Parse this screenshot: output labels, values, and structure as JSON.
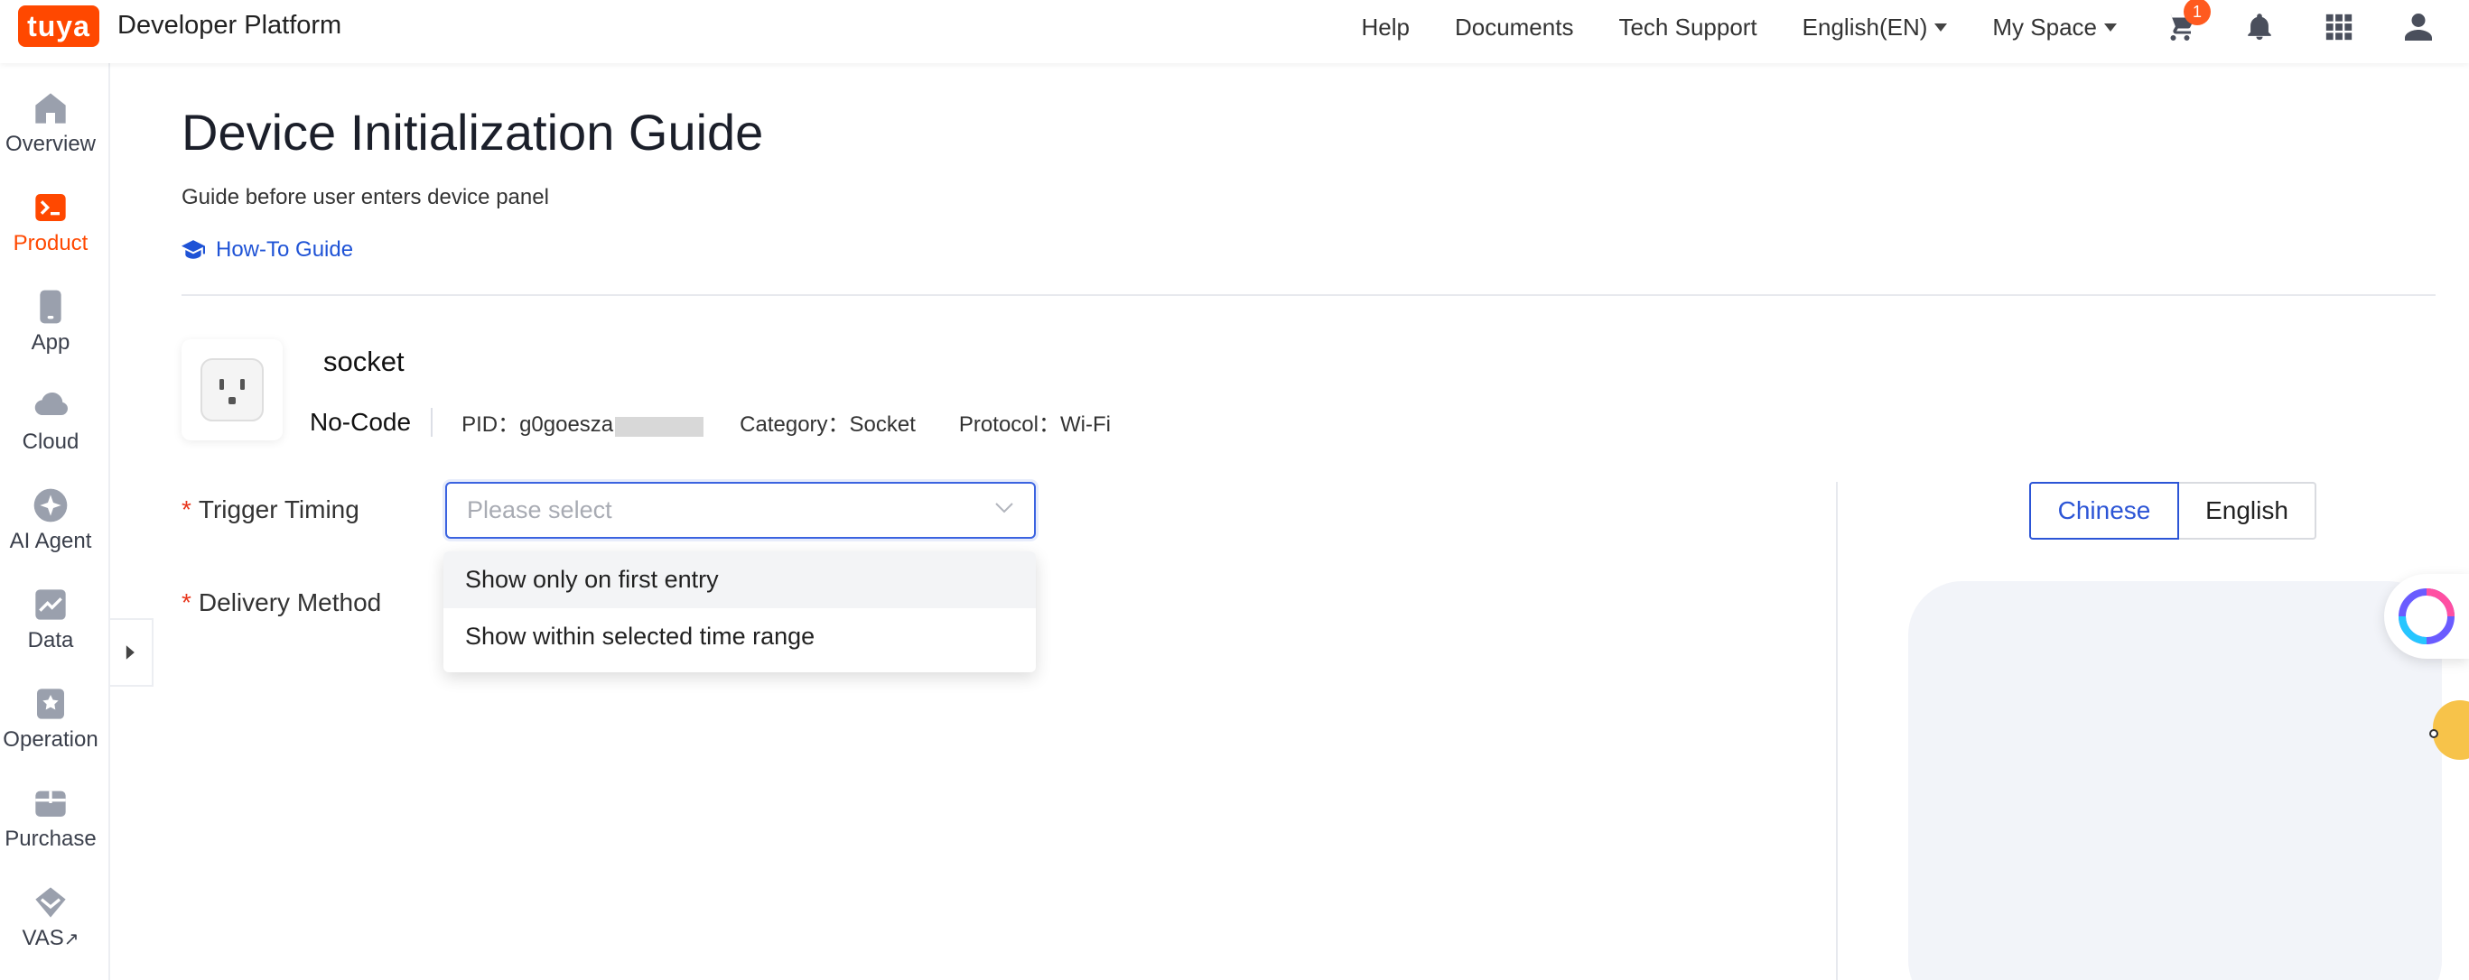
{
  "header": {
    "logo_text": "tuya",
    "brand": "Developer Platform",
    "nav": {
      "help": "Help",
      "documents": "Documents",
      "tech_support": "Tech Support",
      "language": "English(EN)",
      "my_space": "My Space"
    },
    "cart_badge": "1",
    "icons": [
      "cart-icon",
      "bell-icon",
      "apps-grid-icon",
      "user-icon"
    ]
  },
  "sidebar": {
    "items": [
      {
        "label": "Overview",
        "icon": "home-icon"
      },
      {
        "label": "Product",
        "icon": "terminal-icon"
      },
      {
        "label": "App",
        "icon": "phone-icon"
      },
      {
        "label": "Cloud",
        "icon": "cloud-icon"
      },
      {
        "label": "AI Agent",
        "icon": "sparkle-icon"
      },
      {
        "label": "Data",
        "icon": "chart-icon"
      },
      {
        "label": "Operation",
        "icon": "star-bookmark-icon"
      },
      {
        "label": "Purchase",
        "icon": "box-icon"
      },
      {
        "label": "VAS",
        "icon": "diamond-icon"
      }
    ],
    "vas_external": "↗",
    "active": "Product"
  },
  "page": {
    "title": "Device Initialization Guide",
    "subtitle": "Guide before user enters device panel",
    "howto_link": "How-To Guide"
  },
  "product": {
    "name": "socket",
    "mode": "No-Code",
    "pid": "PID：g0goesza",
    "category": "Category：Socket",
    "protocol": "Protocol：Wi-Fi"
  },
  "form": {
    "trigger_timing_label": "Trigger Timing",
    "delivery_method_label": "Delivery Method",
    "required_mark": "*",
    "select_placeholder": "Please select",
    "options": [
      "Show only on first entry",
      "Show within selected time range"
    ]
  },
  "language_toggle": {
    "chinese": "Chinese",
    "english": "English",
    "selected": "Chinese"
  },
  "colors": {
    "brand_orange": "#ff4800",
    "primary_blue": "#2c55d6",
    "required_red": "#e8361c"
  }
}
